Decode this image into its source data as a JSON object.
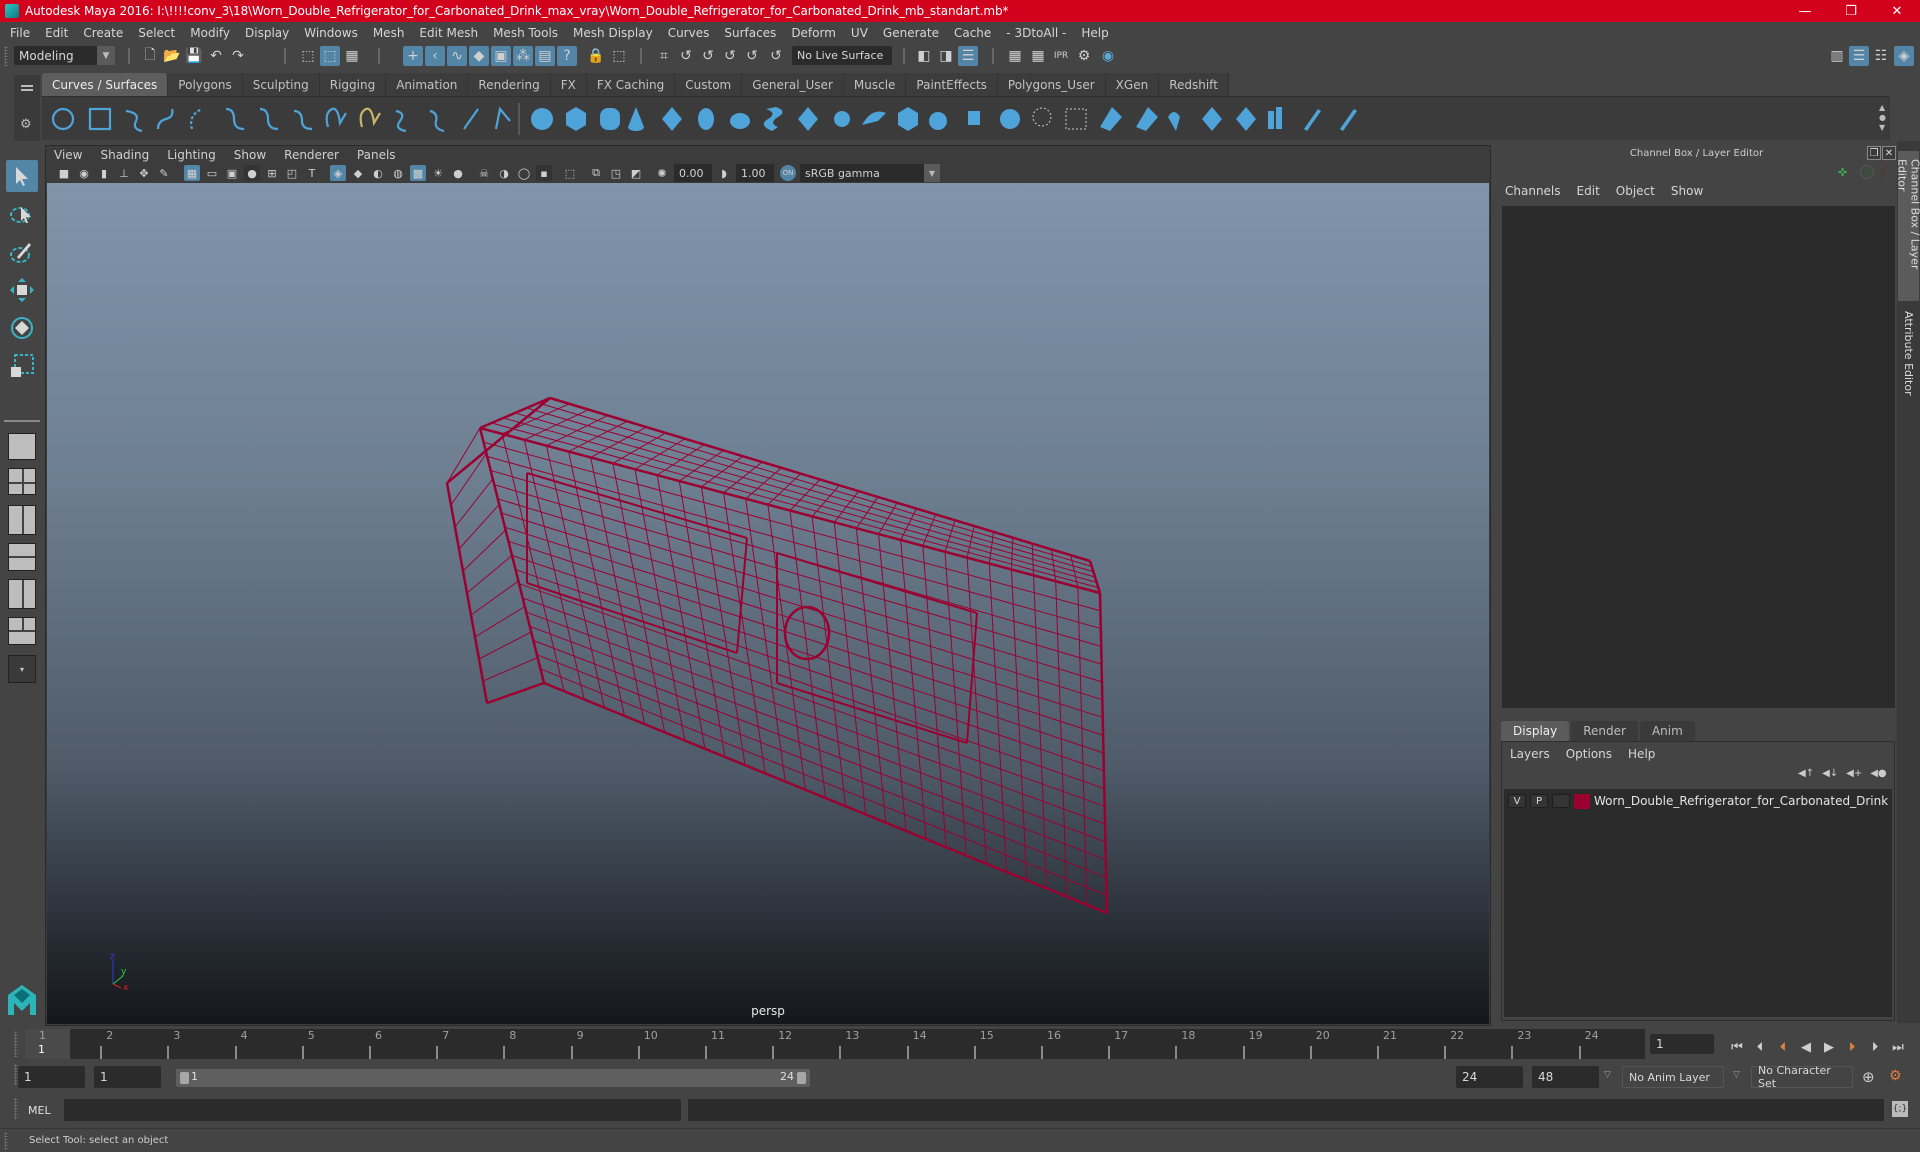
{
  "window": {
    "title": "Autodesk Maya 2016: I:\\!!!!conv_3\\18\\Worn_Double_Refrigerator_for_Carbonated_Drink_max_vray\\Worn_Double_Refrigerator_for_Carbonated_Drink_mb_standart.mb*",
    "controls": {
      "minimize": "—",
      "restore": "❐",
      "close": "✕"
    },
    "title_bar_color": "#d2021c"
  },
  "menubar": [
    "File",
    "Edit",
    "Create",
    "Select",
    "Modify",
    "Display",
    "Windows",
    "Mesh",
    "Edit Mesh",
    "Mesh Tools",
    "Mesh Display",
    "Curves",
    "Surfaces",
    "Deform",
    "UV",
    "Generate",
    "Cache",
    "- 3DtoAll -",
    "Help"
  ],
  "statusline": {
    "menuset": "Modeling",
    "live_surface": "No Live Surface"
  },
  "shelf": {
    "tabs": [
      "Curves / Surfaces",
      "Polygons",
      "Sculpting",
      "Rigging",
      "Animation",
      "Rendering",
      "FX",
      "FX Caching",
      "Custom",
      "General_User",
      "Muscle",
      "PaintEffects",
      "Polygons_User",
      "XGen",
      "Redshift"
    ],
    "active_tab": "Curves / Surfaces",
    "curve_icons": [
      "nurbs-circle",
      "nurbs-square",
      "cv-curve",
      "pencil-curve",
      "ep-curve",
      "bezier-curve",
      "curve-tool",
      "arc-curve",
      "extend-curve",
      "offset-curve",
      "attach-curve",
      "detach-curve",
      "cut-curve",
      "insert-knot"
    ],
    "surface_icons": [
      "nurbs-sphere",
      "nurbs-cube",
      "nurbs-cylinder",
      "nurbs-cone",
      "nurbs-plane",
      "nurbs-torus",
      "revolve",
      "loft",
      "planar",
      "extrude",
      "birail",
      "boundary",
      "square-surface",
      "bevel",
      "trim",
      "untrim",
      "project-curve",
      "intersect",
      "stitch",
      "attach-surface",
      "detach-surface",
      "sculpt",
      "paint",
      "rebuild",
      "insert-isoparm",
      "fillet"
    ]
  },
  "viewport": {
    "menu": [
      "View",
      "Shading",
      "Lighting",
      "Show",
      "Renderer",
      "Panels"
    ],
    "exposure": "0.00",
    "gamma": "1.00",
    "color_space": "sRGB gamma",
    "camera_label": "persp",
    "axis": {
      "x": "x",
      "y": "y",
      "z": "z"
    },
    "wireframe_color": "#9b0030"
  },
  "channel_box": {
    "title": "Channel Box / Layer Editor",
    "menu": [
      "Channels",
      "Edit",
      "Object",
      "Show"
    ]
  },
  "layer_editor": {
    "tabs": [
      "Display",
      "Render",
      "Anim"
    ],
    "active_tab": "Display",
    "menu": [
      "Layers",
      "Options",
      "Help"
    ],
    "layers": [
      {
        "visible": "V",
        "playback": "P",
        "name": "Worn_Double_Refrigerator_for_Carbonated_Drink",
        "color": "#9b0030"
      }
    ]
  },
  "side_tabs": [
    "Channel Box / Layer Editor",
    "Attribute Editor"
  ],
  "timeline": {
    "ticks": [
      "1",
      "2",
      "3",
      "4",
      "5",
      "6",
      "7",
      "8",
      "9",
      "10",
      "11",
      "12",
      "13",
      "14",
      "15",
      "16",
      "17",
      "18",
      "19",
      "20",
      "21",
      "22",
      "23",
      "24"
    ],
    "current_frame_label": "1",
    "current_frame_field": "1"
  },
  "range": {
    "start": "1",
    "playback_start": "1",
    "slider_start": "1",
    "slider_end": "24",
    "playback_end": "24",
    "end": "48",
    "anim_layer": "No Anim Layer",
    "character_set": "No Character Set"
  },
  "command_line": {
    "language": "MEL",
    "input": "",
    "output": ""
  },
  "help_line": "Select Tool: select an object"
}
